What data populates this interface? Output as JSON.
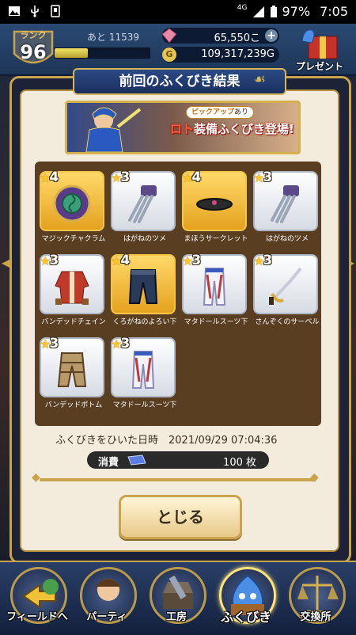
{
  "status_bar": {
    "network": "4G",
    "battery": "97%",
    "time": "7:05"
  },
  "header": {
    "rank_label": "ランク",
    "rank_value": "96",
    "xp_remaining_label": "あと 11539",
    "xp_progress": 0.35,
    "gems": "65,550こ",
    "gold": "109,317,239G",
    "gold_icon": "G",
    "present_label": "プレゼント"
  },
  "modal": {
    "title": "前回のふくびき結果",
    "banner": {
      "tag_pickup": "ピックアップ",
      "tag_suffix": "あり",
      "line_red": "ロト",
      "line_rest": "装備ふくびき登場!"
    },
    "items": [
      {
        "stars": "4",
        "name": "マジックチャクラム",
        "rarity": "gold",
        "icon": "chakram-icon"
      },
      {
        "stars": "3",
        "name": "はがねのツメ",
        "rarity": "white",
        "icon": "claw-icon"
      },
      {
        "stars": "4",
        "name": "まほうサークレット",
        "rarity": "gold",
        "icon": "circlet-icon"
      },
      {
        "stars": "3",
        "name": "はがねのツメ",
        "rarity": "white",
        "icon": "claw-icon"
      },
      {
        "stars": "3",
        "name": "バンデッドチェイン",
        "rarity": "white",
        "icon": "jacket-icon"
      },
      {
        "stars": "4",
        "name": "くろがねのよろい下",
        "rarity": "gold",
        "icon": "armor-pants-icon"
      },
      {
        "stars": "3",
        "name": "マタドールスーツ下",
        "rarity": "white",
        "icon": "suit-pants-icon"
      },
      {
        "stars": "3",
        "name": "さんぞくのサーベル",
        "rarity": "white",
        "icon": "saber-icon"
      },
      {
        "stars": "3",
        "name": "バンデッドボトム",
        "rarity": "white",
        "icon": "bandit-pants-icon"
      },
      {
        "stars": "3",
        "name": "マタドールスーツ下",
        "rarity": "white",
        "icon": "suit-pants-icon"
      }
    ],
    "draw_date": "ふくびきをひいた日時　2021/09/29 07:04:36",
    "consume_label": "消費",
    "consume_value": "100 枚",
    "close_label": "とじる"
  },
  "nav": [
    {
      "label": "フィールドへ",
      "icon": "field-icon"
    },
    {
      "label": "パーティ",
      "icon": "party-icon"
    },
    {
      "label": "工房",
      "icon": "workshop-icon"
    },
    {
      "label": "ふくびき",
      "icon": "fukubiki-icon"
    },
    {
      "label": "交換所",
      "icon": "exchange-icon"
    }
  ]
}
